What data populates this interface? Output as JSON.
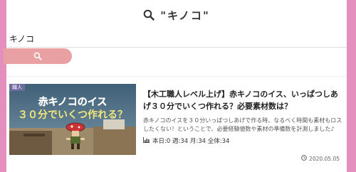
{
  "search": {
    "heading": "\"キノコ\"",
    "query": "キノコ"
  },
  "post": {
    "category": "職人",
    "thumb_line1": "赤キノコのイス",
    "thumb_line2": "３０分でいくつ作れる？",
    "title": "【木工職人レベル上げ】赤キノコのイス、いっぱつしあげ３０分でいくつ作れる？必要素材数は？",
    "excerpt": "赤キノコのイスを３０分いっぱつしあげで作る時、なるべく時間も素材もロスしたくない！ということで、必要経験値数や素材の準備数を計測しました♪",
    "stats": "本日:0  週:34  月:34  全体:34",
    "date": "2020.05.05"
  },
  "colors": {
    "side_border": "#e48fbd",
    "search_button": "#e8a0a3",
    "badge": "#6f6aa0"
  },
  "icons": [
    "search-icon",
    "bar-chart-icon",
    "clock-icon",
    "character-icon"
  ]
}
